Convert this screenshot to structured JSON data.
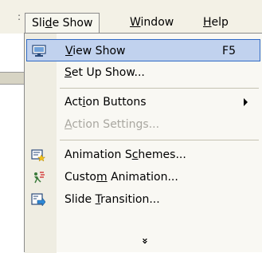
{
  "menubar": {
    "grip": ":",
    "items": [
      {
        "label": "Slide Show",
        "pre": "Sli",
        "acc": "d",
        "post": "e Show"
      },
      {
        "label": "Window",
        "pre": "",
        "acc": "W",
        "post": "indow"
      },
      {
        "label": "Help",
        "pre": "",
        "acc": "H",
        "post": "elp"
      }
    ]
  },
  "menu": {
    "items": [
      {
        "pre": "",
        "acc": "V",
        "post": "iew Show",
        "shortcut": "F5",
        "icon": "projector-screen-icon",
        "state": "highlighted"
      },
      {
        "pre": "",
        "acc": "S",
        "post": "et Up Show...",
        "shortcut": "",
        "icon": "",
        "state": "normal"
      },
      {
        "pre": "Act",
        "acc": "i",
        "post": "on Buttons",
        "shortcut": "",
        "icon": "",
        "state": "submenu"
      },
      {
        "pre": "",
        "acc": "A",
        "post": "ction Settings...",
        "shortcut": "",
        "icon": "",
        "state": "disabled"
      },
      {
        "pre": "Animation S",
        "acc": "c",
        "post": "hemes...",
        "shortcut": "",
        "icon": "animation-schemes-icon",
        "state": "normal"
      },
      {
        "pre": "Custo",
        "acc": "m",
        "post": " Animation...",
        "shortcut": "",
        "icon": "custom-animation-icon",
        "state": "normal"
      },
      {
        "pre": "Slide ",
        "acc": "T",
        "post": "ransition...",
        "shortcut": "",
        "icon": "slide-transition-icon",
        "state": "normal"
      }
    ],
    "expand_glyph": "»"
  },
  "colors": {
    "menubar_bg": "#f3f1e6",
    "menu_bg": "#f9f8f3",
    "highlight_bg": "#c1d2ee",
    "highlight_border": "#316ac5",
    "disabled_text": "#a9a7a0"
  }
}
